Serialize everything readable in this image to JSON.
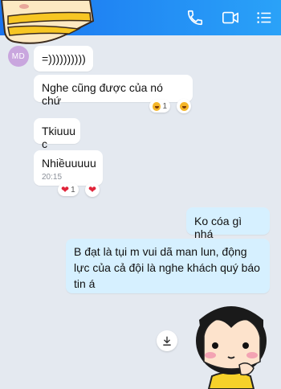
{
  "header": {
    "call_icon": "phone-icon",
    "video_icon": "video-call-icon",
    "menu_icon": "menu-list-icon",
    "accent_from": "#1a74f0",
    "accent_to": "#2aa2f8"
  },
  "contact": {
    "avatar_initials": "MD"
  },
  "messages": [
    {
      "text": "=))))))))))"
    },
    {
      "text": "Nghe cũng được của nó chứ",
      "reaction_count": "1"
    },
    {
      "text": "Tkiuuu c"
    },
    {
      "text": "Nhiềuuuuu",
      "time": "20:15",
      "reaction_count": "1"
    },
    {
      "text": "Ko cóa gì nhá"
    },
    {
      "text": "B đạt là tụi m vui dã man lun, động lực của cả đội là nghe khách quý báo tin á"
    }
  ],
  "sticker": {
    "icon": "girl-sticker",
    "download_icon": "download-icon"
  }
}
